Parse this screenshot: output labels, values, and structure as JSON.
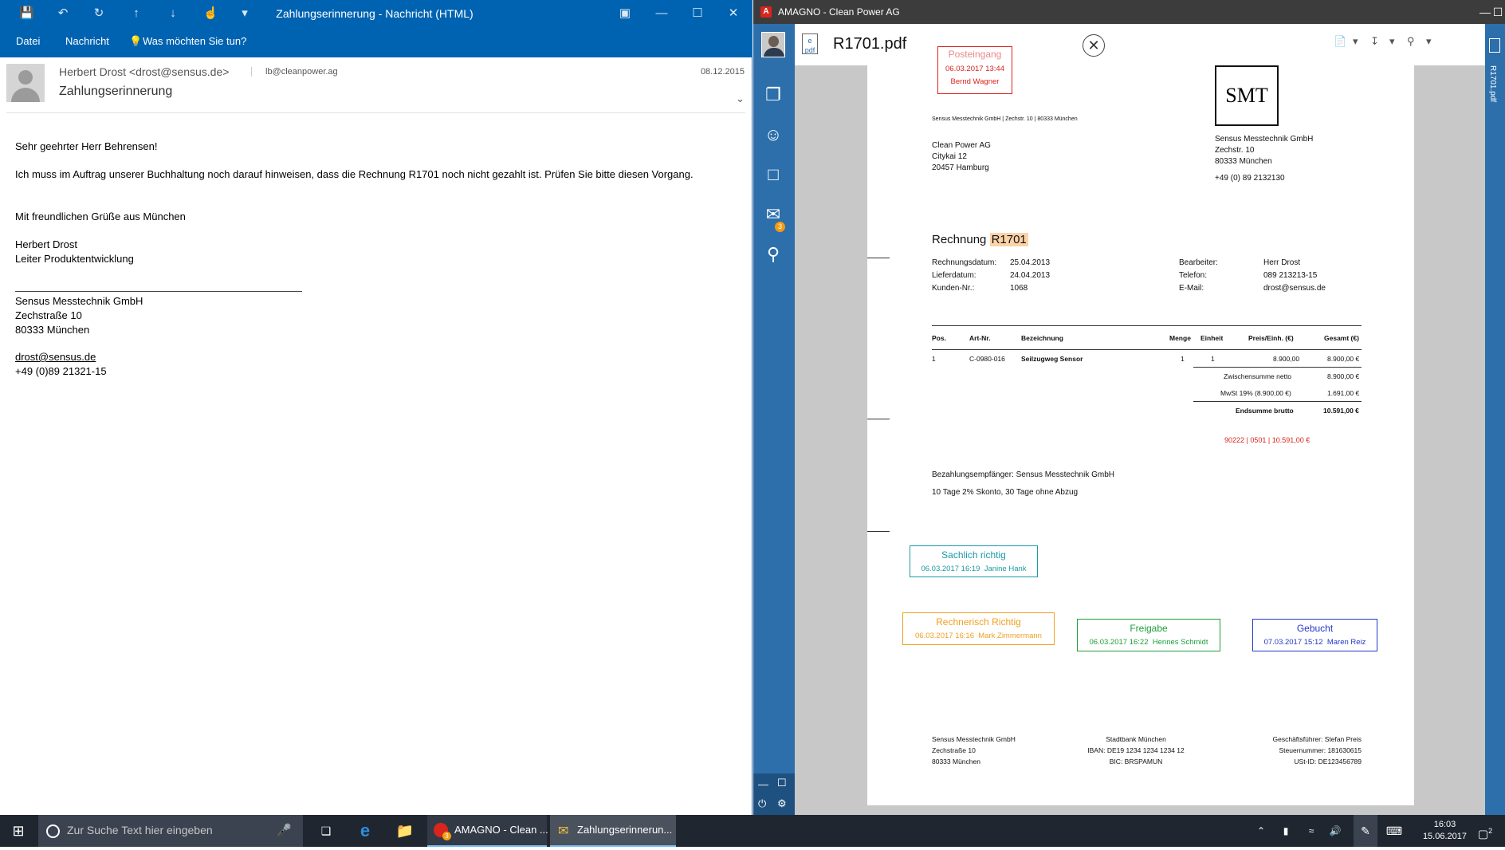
{
  "outlook": {
    "window_title": "Zahlungserinnerung  -  Nachricht (HTML)",
    "ribbon": {
      "file": "Datei",
      "message": "Nachricht",
      "tell_me": "Was möchten Sie tun?"
    },
    "from": "Herbert Drost <drost@sensus.de>",
    "to": "lb@cleanpower.ag",
    "date": "08.12.2015",
    "subject": "Zahlungserinnerung",
    "body": {
      "greeting": "Sehr geehrter Herr Behrensen!",
      "text": "Ich muss im Auftrag unserer Buchhaltung noch darauf hinweisen, dass die Rechnung R1701 noch nicht gezahlt ist. Prüfen Sie bitte diesen Vorgang.",
      "closing": "Mit freundlichen Grüße aus München",
      "name": "Herbert Drost",
      "role": "Leiter Produktentwicklung",
      "company": "Sensus Messtechnik GmbH",
      "street": "Zechstraße 10",
      "city": "80333 München",
      "email": "drost@sensus.de",
      "phone": "+49 (0)89 21321-15"
    }
  },
  "amagno": {
    "window_title": "AMAGNO - Clean Power AG",
    "document_title": "R1701.pdf",
    "right_tab": "R1701.pdf",
    "inbox_badge": "3"
  },
  "invoice": {
    "stamp_inbox": {
      "title": "Posteingang",
      "date": "06.03.2017 13:44",
      "user": "Bernd Wagner"
    },
    "sender_line": "Sensus Messtechnik GmbH |  Zechstr. 10 | 80333 München",
    "recipient": [
      "Clean Power AG",
      "Citykai 12",
      "20457 Hamburg"
    ],
    "logo": "SMT",
    "sender": [
      "Sensus Messtechnik GmbH",
      "Zechstr. 10",
      "80333 München"
    ],
    "sender_phone": "+49 (0) 89 2132130",
    "title_prefix": "Rechnung",
    "title_number": "R1701",
    "meta_left": [
      {
        "label": "Rechnungsdatum:",
        "value": "25.04.2013"
      },
      {
        "label": "Lieferdatum:",
        "value": "24.04.2013"
      },
      {
        "label": "Kunden-Nr.:",
        "value": "1068"
      }
    ],
    "meta_right": [
      {
        "label": "Bearbeiter:",
        "value": "Herr Drost"
      },
      {
        "label": "Telefon:",
        "value": "089 213213-15"
      },
      {
        "label": "E-Mail:",
        "value": "drost@sensus.de"
      }
    ],
    "columns": [
      "Pos.",
      "Art-Nr.",
      "Bezeichnung",
      "Menge",
      "Einheit",
      "Preis/Einh. (€)",
      "Gesamt (€)"
    ],
    "row": [
      "1",
      "C-0980-016",
      "Seilzugweg Sensor",
      "1",
      "1",
      "8.900,00",
      "8.900,00 €"
    ],
    "subtotal_label": "Zwischensumme netto",
    "subtotal": "8.900,00 €",
    "vat_label": "MwSt 19% (8.900,00 €)",
    "vat": "1.691,00 €",
    "total_label": "Endsumme brutto",
    "total": "10.591,00 €",
    "booking_code": "90222 | 0501 | 10.591,00 €",
    "payee": "Bezahlungsempfänger: Sensus Messtechnik GmbH",
    "terms": "10 Tage 2% Skonto, 30 Tage ohne Abzug",
    "stamps": {
      "sachlich": {
        "title": "Sachlich richtig",
        "date": "06.03.2017 16:19",
        "user": "Janine Hank",
        "color": "#1a9aa5"
      },
      "rechnerisch": {
        "title": "Rechnerisch Richtig",
        "date": "06.03.2017 16:16",
        "user": "Mark Zimmermann",
        "color": "#f0a020"
      },
      "freigabe": {
        "title": "Freigabe",
        "date": "06.03.2017 16:22",
        "user": "Hennes Schmidt",
        "color": "#1e9e3a"
      },
      "gebucht": {
        "title": "Gebucht",
        "date": "07.03.2017 15:12",
        "user": "Maren Reiz",
        "color": "#2438c8"
      }
    },
    "footer_left": [
      "Sensus Messtechnik GmbH",
      "Zechstraße 10",
      "80333 München"
    ],
    "footer_mid": [
      "Stadtbank München",
      "IBAN: DE19 1234 1234 1234 12",
      "BIC: BRSPAMUN"
    ],
    "footer_right": [
      "Geschäftsführer: Stefan Preis",
      "Steuernummer: 181630615",
      "USt-ID: DE123456789"
    ]
  },
  "taskbar": {
    "search_placeholder": "Zur Suche Text hier eingeben",
    "apps": [
      {
        "label": "AMAGNO - Clean ...",
        "badge": "3"
      },
      {
        "label": "Zahlungserinnerun..."
      }
    ],
    "time": "16:03",
    "date": "15.06.2017",
    "notifications": "2"
  }
}
